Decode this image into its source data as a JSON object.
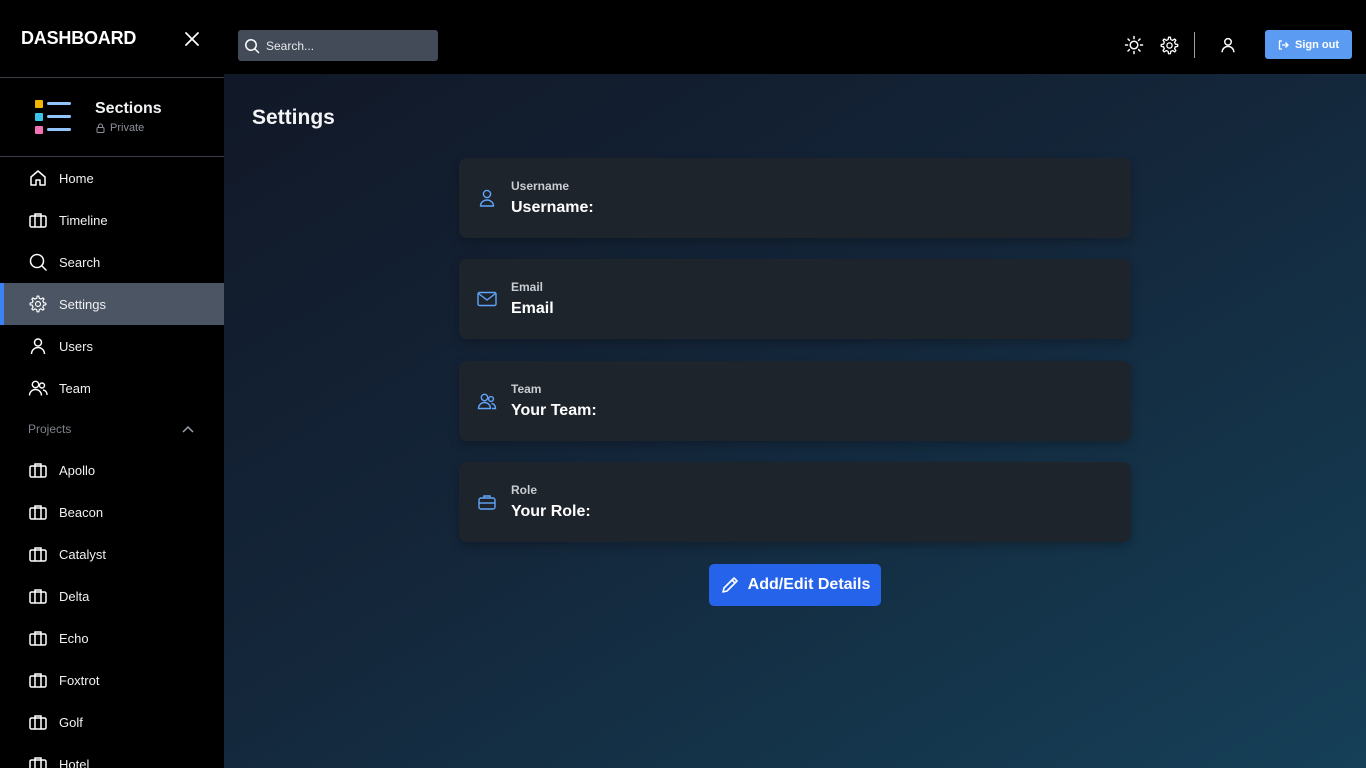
{
  "sidebar": {
    "brand": "DASHBOARD",
    "section": {
      "title": "Sections",
      "visibility": "Private",
      "logo_colors": [
        "#f5b400",
        "#3ac6e8",
        "#f472b6",
        "#93c5fd"
      ]
    },
    "nav": [
      {
        "label": "Home",
        "icon": "home-icon"
      },
      {
        "label": "Timeline",
        "icon": "briefcase-icon"
      },
      {
        "label": "Search",
        "icon": "search-icon"
      },
      {
        "label": "Settings",
        "icon": "gear-icon",
        "active": true
      },
      {
        "label": "Users",
        "icon": "user-icon"
      },
      {
        "label": "Team",
        "icon": "users-icon"
      }
    ],
    "projects_label": "Projects",
    "projects": [
      {
        "label": "Apollo",
        "icon": "briefcase-icon"
      },
      {
        "label": "Beacon",
        "icon": "briefcase-icon"
      },
      {
        "label": "Catalyst",
        "icon": "briefcase-icon"
      },
      {
        "label": "Delta",
        "icon": "briefcase-icon"
      },
      {
        "label": "Echo",
        "icon": "briefcase-icon"
      },
      {
        "label": "Foxtrot",
        "icon": "briefcase-icon"
      },
      {
        "label": "Golf",
        "icon": "briefcase-icon"
      },
      {
        "label": "Hotel",
        "icon": "briefcase-icon"
      }
    ]
  },
  "topbar": {
    "search_placeholder": "Search...",
    "signout_label": "Sign out",
    "accent": "#5b9cf2"
  },
  "main": {
    "title": "Settings",
    "cards": [
      {
        "label": "Username",
        "value": "Username:",
        "icon": "user-icon"
      },
      {
        "label": "Email",
        "value": "Email",
        "icon": "mail-icon"
      },
      {
        "label": "Team",
        "value": "Your Team:",
        "icon": "users-icon"
      },
      {
        "label": "Role",
        "value": "Your Role:",
        "icon": "briefcase-icon"
      }
    ],
    "edit_label": "Add/Edit Details",
    "icon_color": "#60a5fa",
    "button_color": "#2563eb"
  }
}
